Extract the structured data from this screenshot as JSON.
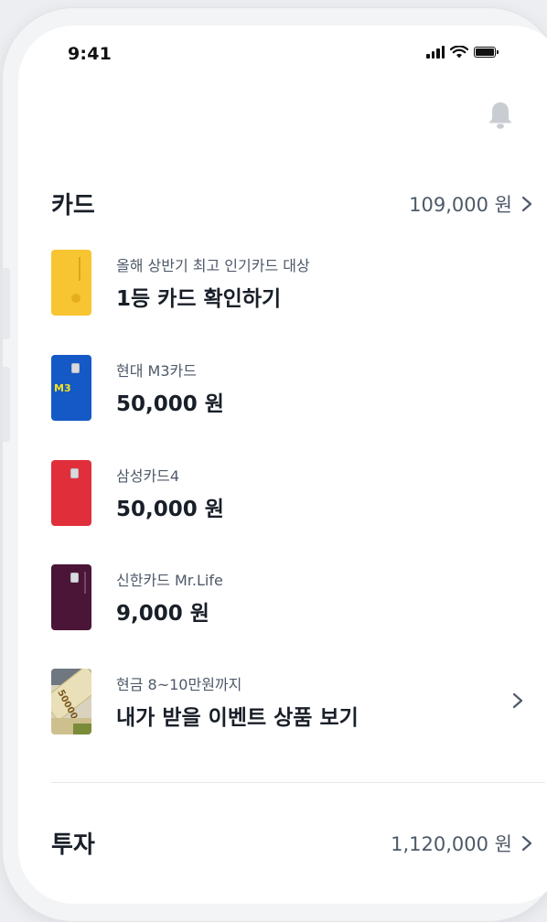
{
  "status_bar": {
    "time": "9:41"
  },
  "colors": {
    "card_yellow": "#f7c531",
    "card_blue": "#1559c7",
    "card_red": "#e02f3b",
    "card_purple": "#4a1537",
    "text_primary": "#191f28",
    "text_secondary": "#4e5968"
  },
  "card_section": {
    "title": "카드",
    "total": "109,000 원",
    "items": [
      {
        "subtitle": "올해 상반기 최고 인기카드 대상",
        "main": "1등 카드 확인하기",
        "icon": "yellow-card-icon"
      },
      {
        "subtitle": "현대 M3카드",
        "main": "50,000 원",
        "icon": "hyundai-m3-card-icon",
        "card_label": "M3"
      },
      {
        "subtitle": "삼성카드4",
        "main": "50,000 원",
        "icon": "samsung-card-icon"
      },
      {
        "subtitle": "신한카드 Mr.Life",
        "main": "9,000 원",
        "icon": "shinhan-card-icon"
      },
      {
        "subtitle": "현금 8~10만원까지",
        "main": "내가 받을 이벤트 상품 보기",
        "icon": "cash-banknote-icon",
        "note_value": "50000"
      }
    ]
  },
  "invest_section": {
    "title": "투자",
    "total": "1,120,000 원"
  }
}
